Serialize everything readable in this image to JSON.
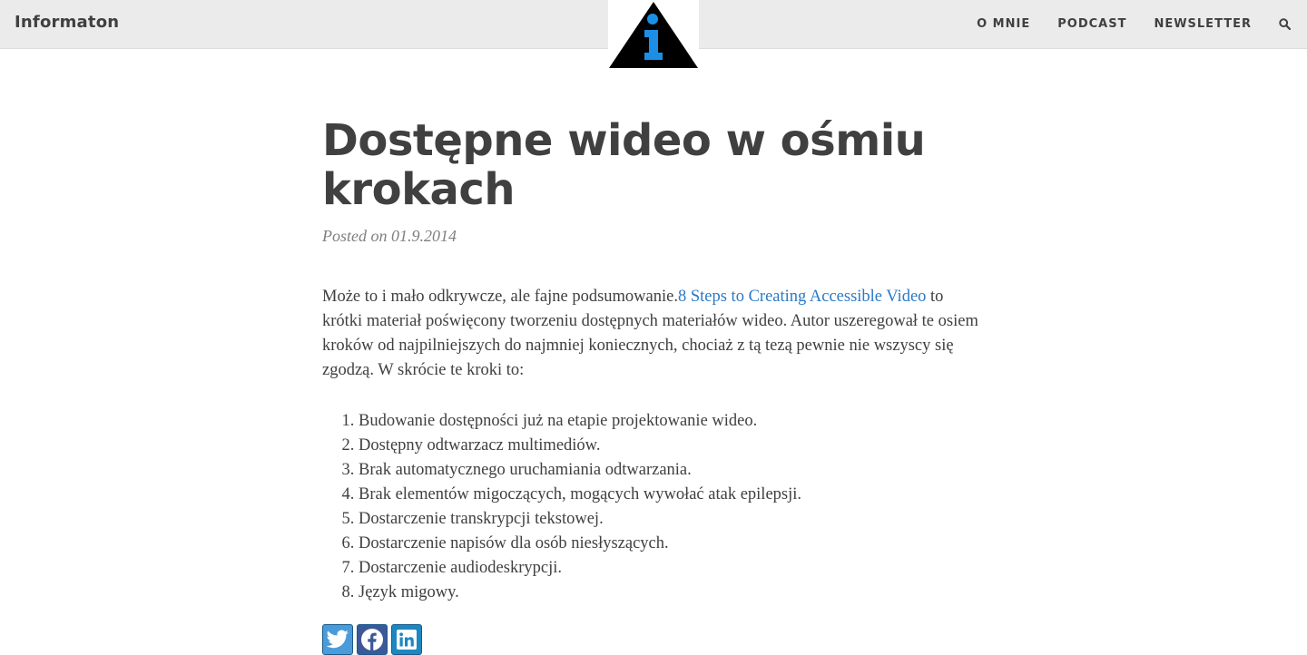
{
  "header": {
    "brand": "Informaton",
    "nav": [
      "O MNIE",
      "PODCAST",
      "NEWSLETTER"
    ]
  },
  "post": {
    "title": "Dostępne wideo w ośmiu krokach",
    "meta": "Posted on 01.9.2014",
    "intro_before_link": "Może to i mało odkrywcze, ale fajne podsumowanie.",
    "link_text": "8 Steps to Creating Accessible Video",
    "intro_after_link": " to krótki materiał poświęcony tworzeniu dostępnych materiałów wideo. Autor uszeregował te osiem kroków od najpilniejszych do najmniej koniecznych, chociaż z tą tezą pewnie nie wszyscy się zgodzą. W skrócie te kroki to:",
    "steps": [
      "Budowanie dostępności już na etapie projektowanie wideo.",
      "Dostępny odtwarzacz multimediów.",
      "Brak automatycznego uruchamiania odtwarzania.",
      "Brak elementów migoczących, mogących wywołać atak epilepsji.",
      "Dostarczenie transkrypcji tekstowej.",
      "Dostarczenie napisów dla osób niesłyszących.",
      "Dostarczenie audiodeskrypcji.",
      "Język migowy."
    ]
  },
  "icons": {
    "logo": "info-triangle-logo",
    "search": "search-icon",
    "share": [
      "twitter-icon",
      "facebook-icon",
      "linkedin-icon"
    ]
  },
  "colors": {
    "navbar_bg": "#ebebeb",
    "text": "#404040",
    "link": "#2a7ac7",
    "logo_accent": "#1b8fe6"
  }
}
